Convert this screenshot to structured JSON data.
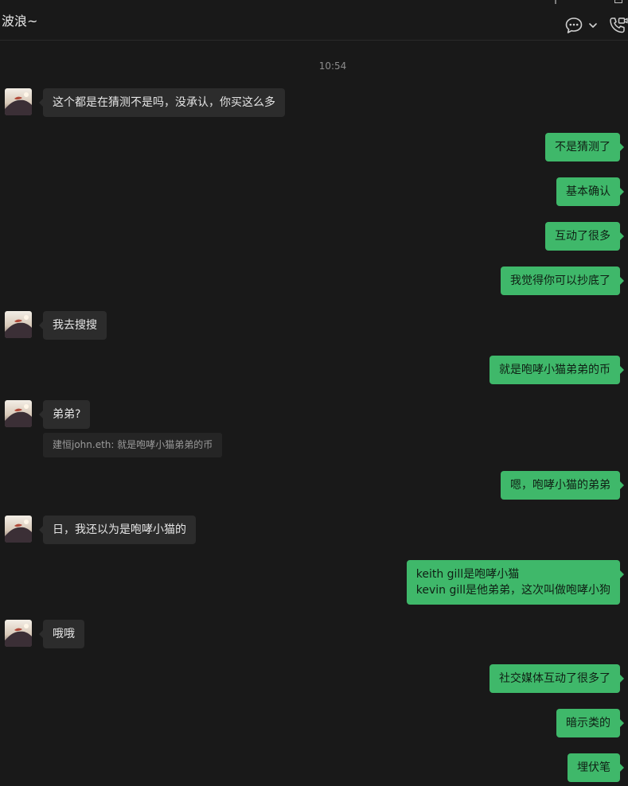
{
  "header": {
    "title": "波浪~",
    "icons": {
      "chat_menu": "chat-bubble-icon",
      "dropdown": "chevron-down-icon",
      "call": "phone-video-icon"
    }
  },
  "messages": {
    "timestamp": "10:54",
    "items": [
      {
        "dir": "in",
        "text": "这个都是在猜测不是吗，没承认，你买这么多"
      },
      {
        "dir": "out",
        "text": "不是猜测了"
      },
      {
        "dir": "out",
        "text": "基本确认"
      },
      {
        "dir": "out",
        "text": "互动了很多"
      },
      {
        "dir": "out",
        "text": "我觉得你可以抄底了"
      },
      {
        "dir": "in",
        "text": "我去搜搜"
      },
      {
        "dir": "out",
        "text": "就是咆哮小猫弟弟的币"
      },
      {
        "dir": "in",
        "text": "弟弟?",
        "quote": "建恒john.eth: 就是咆哮小猫弟弟的币"
      },
      {
        "dir": "out",
        "text": "嗯，咆哮小猫的弟弟"
      },
      {
        "dir": "in",
        "text": "日，我还以为是咆哮小猫的"
      },
      {
        "dir": "out",
        "lines": [
          "keith gill是咆哮小猫",
          "kevin gill是他弟弟，这次叫做咆哮小狗"
        ]
      },
      {
        "dir": "in",
        "text": "哦哦"
      },
      {
        "dir": "out",
        "text": "社交媒体互动了很多了"
      },
      {
        "dir": "out",
        "text": "暗示类的"
      },
      {
        "dir": "out",
        "text": "埋伏笔"
      }
    ]
  },
  "colors": {
    "background": "#191919",
    "incoming_bubble": "#2c2c2c",
    "outgoing_bubble": "#3fb86a",
    "quote_background": "#252525"
  }
}
